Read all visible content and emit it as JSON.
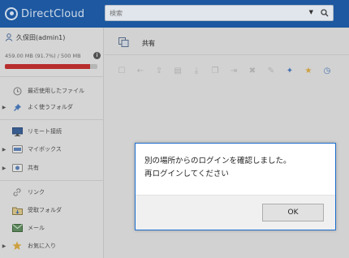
{
  "app": {
    "name": "DirectCloud"
  },
  "search": {
    "placeholder": "検索"
  },
  "user": {
    "name": "久保田(admin1)"
  },
  "storage": {
    "usage_text": "459.00 MB (91.7%) / 500 MB",
    "used_fraction": 0.917,
    "bar_color": "#bd2f2f"
  },
  "sidebar": {
    "items": [
      {
        "label": "最近使用したファイル",
        "icon": "clock-icon",
        "expandable": false
      },
      {
        "label": "よく使うフォルダ",
        "icon": "pin-icon",
        "expandable": true
      },
      {
        "label": "リモート接続",
        "icon": "monitor-icon",
        "expandable": false
      },
      {
        "label": "マイボックス",
        "icon": "drive-icon",
        "expandable": true
      },
      {
        "label": "共有",
        "icon": "shared-drive-icon",
        "expandable": true
      },
      {
        "label": "リンク",
        "icon": "link-icon",
        "expandable": false
      },
      {
        "label": "受取フォルダ",
        "icon": "inbox-folder-icon",
        "expandable": false
      },
      {
        "label": "メール",
        "icon": "mail-icon",
        "expandable": false
      },
      {
        "label": "お気に入り",
        "icon": "star-icon",
        "expandable": true
      }
    ]
  },
  "main": {
    "breadcrumb": "共有"
  },
  "dialog": {
    "message_line1": "別の場所からのログインを確認しました。",
    "message_line2": "再ログインしてください",
    "ok_label": "OK"
  },
  "colors": {
    "header": "#1e5ba6",
    "dialog_border": "#1c6fd1"
  }
}
